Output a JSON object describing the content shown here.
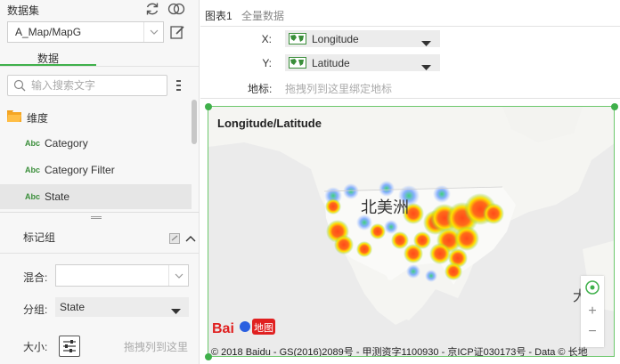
{
  "dataset": {
    "header": "数据集",
    "selected": "A_Map/MapG",
    "tab_label": "数据",
    "search_placeholder": "输入搜索文字"
  },
  "fields": {
    "folder": "维度",
    "items": [
      {
        "type_icon": "Abc",
        "label": "Category",
        "selected": false
      },
      {
        "type_icon": "Abc",
        "label": "Category Filter",
        "selected": false
      },
      {
        "type_icon": "Abc",
        "label": "State",
        "selected": true
      }
    ]
  },
  "marks": {
    "title": "标记组",
    "mix_label": "混合:",
    "mix_value": "",
    "group_label": "分组:",
    "group_value": "State",
    "size_label": "大小:",
    "size_drop": "拖拽列到这里"
  },
  "chart_tabs": [
    "图表1",
    "全量数据"
  ],
  "bindings": {
    "x_label": "X:",
    "x_value": "Longitude",
    "y_label": "Y:",
    "y_value": "Latitude",
    "geo_label": "地标:",
    "geo_placeholder": "拖拽列到这里绑定地标"
  },
  "map": {
    "title": "Longitude/Latitude",
    "label_na": "北美洲",
    "label_sea": "大西",
    "copyright": "© 2018 Baidu - GS(2016)2089号 - 甲测资字1100930 - 京ICP证030173号 - Data © 长地",
    "logo_text": "Bai",
    "logo_text2": "地图",
    "zoom_in": "+",
    "zoom_out": "−"
  },
  "colors": {
    "accent": "#3fb04b",
    "heat_high": "#ff4a1a",
    "heat_mid": "#ffe000",
    "heat_low": "#7fd24a",
    "heat_cool": "#7aa8ff"
  }
}
